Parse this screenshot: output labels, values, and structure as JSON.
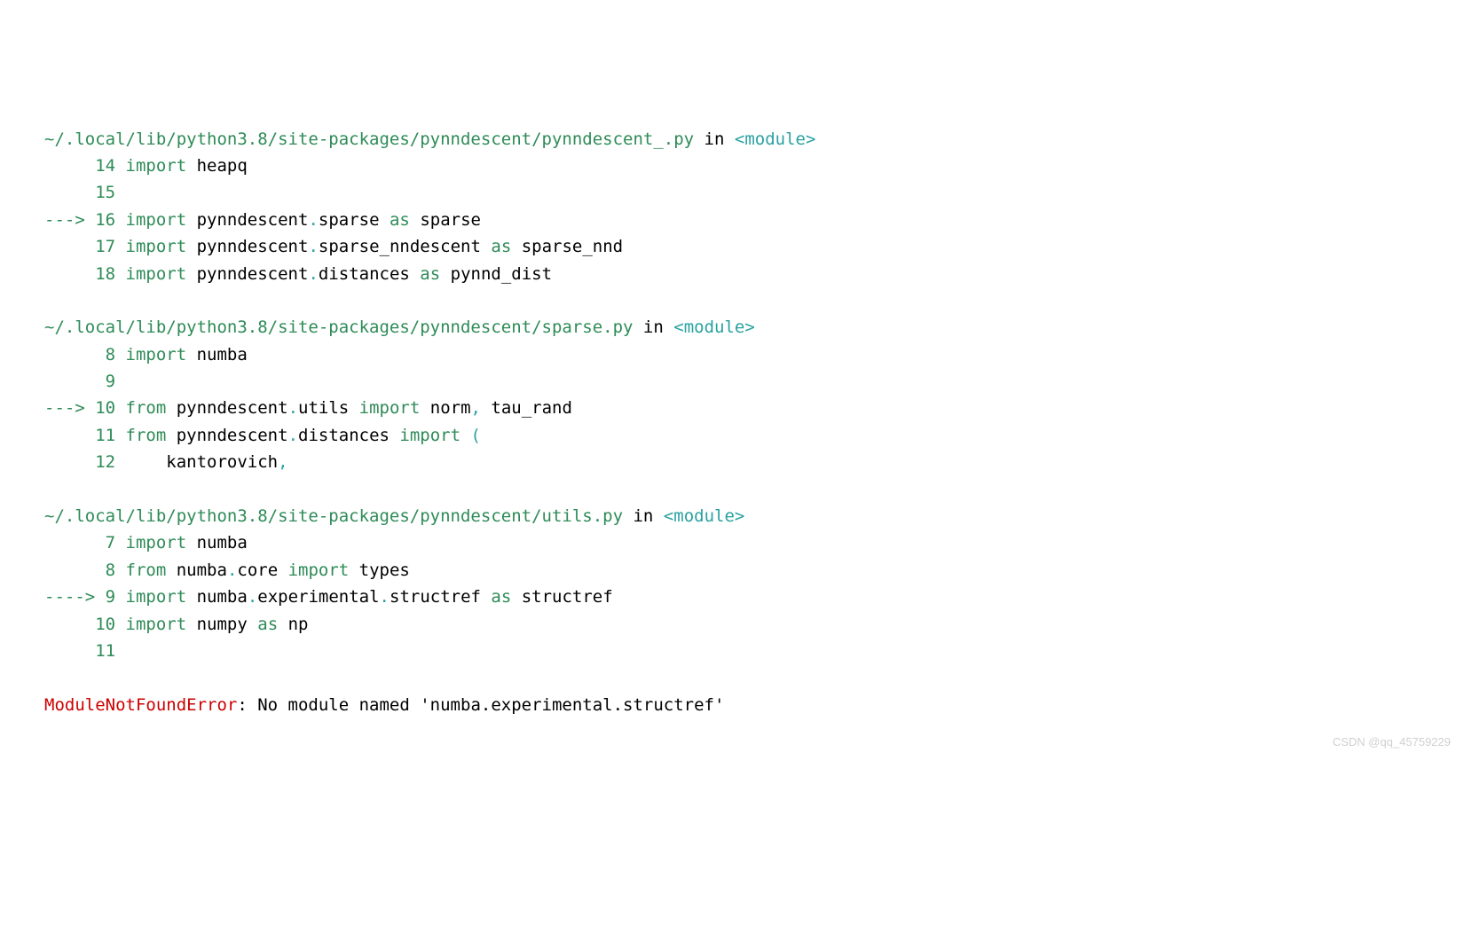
{
  "frames": [
    {
      "path": "~/.local/lib/python3.8/site-packages/pynndescent/pynndescent_.py",
      "in_kw": "in",
      "lt": "<",
      "module": "module",
      "gt": ">",
      "lines": [
        {
          "prefix": "     ",
          "lineno": "14",
          "tokens": [
            {
              "t": "green",
              "v": " import"
            },
            {
              "t": "black",
              "v": " heapq"
            }
          ]
        },
        {
          "prefix": "     ",
          "lineno": "15",
          "tokens": []
        },
        {
          "prefix": "---> ",
          "lineno": "16",
          "tokens": [
            {
              "t": "green",
              "v": " import"
            },
            {
              "t": "black",
              "v": " pynndescent"
            },
            {
              "t": "cyan",
              "v": "."
            },
            {
              "t": "black",
              "v": "sparse "
            },
            {
              "t": "green",
              "v": "as"
            },
            {
              "t": "black",
              "v": " sparse"
            }
          ]
        },
        {
          "prefix": "     ",
          "lineno": "17",
          "tokens": [
            {
              "t": "green",
              "v": " import"
            },
            {
              "t": "black",
              "v": " pynndescent"
            },
            {
              "t": "cyan",
              "v": "."
            },
            {
              "t": "black",
              "v": "sparse_nndescent "
            },
            {
              "t": "green",
              "v": "as"
            },
            {
              "t": "black",
              "v": " sparse_nnd"
            }
          ]
        },
        {
          "prefix": "     ",
          "lineno": "18",
          "tokens": [
            {
              "t": "green",
              "v": " import"
            },
            {
              "t": "black",
              "v": " pynndescent"
            },
            {
              "t": "cyan",
              "v": "."
            },
            {
              "t": "black",
              "v": "distances "
            },
            {
              "t": "green",
              "v": "as"
            },
            {
              "t": "black",
              "v": " pynnd_dist"
            }
          ]
        }
      ]
    },
    {
      "path": "~/.local/lib/python3.8/site-packages/pynndescent/sparse.py",
      "in_kw": "in",
      "lt": "<",
      "module": "module",
      "gt": ">",
      "lines": [
        {
          "prefix": "      ",
          "lineno": "8",
          "tokens": [
            {
              "t": "green",
              "v": " import"
            },
            {
              "t": "black",
              "v": " numba"
            }
          ]
        },
        {
          "prefix": "      ",
          "lineno": "9",
          "tokens": []
        },
        {
          "prefix": "---> ",
          "lineno": "10",
          "tokens": [
            {
              "t": "green",
              "v": " from"
            },
            {
              "t": "black",
              "v": " pynndescent"
            },
            {
              "t": "cyan",
              "v": "."
            },
            {
              "t": "black",
              "v": "utils "
            },
            {
              "t": "green",
              "v": "import"
            },
            {
              "t": "black",
              "v": " norm"
            },
            {
              "t": "cyan",
              "v": ","
            },
            {
              "t": "black",
              "v": " tau_rand"
            }
          ]
        },
        {
          "prefix": "     ",
          "lineno": "11",
          "tokens": [
            {
              "t": "green",
              "v": " from"
            },
            {
              "t": "black",
              "v": " pynndescent"
            },
            {
              "t": "cyan",
              "v": "."
            },
            {
              "t": "black",
              "v": "distances "
            },
            {
              "t": "green",
              "v": "import"
            },
            {
              "t": "cyan",
              "v": " ("
            }
          ]
        },
        {
          "prefix": "     ",
          "lineno": "12",
          "tokens": [
            {
              "t": "black",
              "v": "     kantorovich"
            },
            {
              "t": "cyan",
              "v": ","
            }
          ]
        }
      ]
    },
    {
      "path": "~/.local/lib/python3.8/site-packages/pynndescent/utils.py",
      "in_kw": "in",
      "lt": "<",
      "module": "module",
      "gt": ">",
      "lines": [
        {
          "prefix": "      ",
          "lineno": "7",
          "tokens": [
            {
              "t": "green",
              "v": " import"
            },
            {
              "t": "black",
              "v": " numba"
            }
          ]
        },
        {
          "prefix": "      ",
          "lineno": "8",
          "tokens": [
            {
              "t": "green",
              "v": " from"
            },
            {
              "t": "black",
              "v": " numba"
            },
            {
              "t": "cyan",
              "v": "."
            },
            {
              "t": "black",
              "v": "core "
            },
            {
              "t": "green",
              "v": "import"
            },
            {
              "t": "black",
              "v": " types"
            }
          ]
        },
        {
          "prefix": "----> ",
          "lineno": "9",
          "tokens": [
            {
              "t": "green",
              "v": " import"
            },
            {
              "t": "black",
              "v": " numba"
            },
            {
              "t": "cyan",
              "v": "."
            },
            {
              "t": "black",
              "v": "experimental"
            },
            {
              "t": "cyan",
              "v": "."
            },
            {
              "t": "black",
              "v": "structref "
            },
            {
              "t": "green",
              "v": "as"
            },
            {
              "t": "black",
              "v": " structref"
            }
          ]
        },
        {
          "prefix": "     ",
          "lineno": "10",
          "tokens": [
            {
              "t": "green",
              "v": " import"
            },
            {
              "t": "black",
              "v": " numpy "
            },
            {
              "t": "green",
              "v": "as"
            },
            {
              "t": "black",
              "v": " np"
            }
          ]
        },
        {
          "prefix": "     ",
          "lineno": "11",
          "tokens": []
        }
      ]
    }
  ],
  "error": {
    "name": "ModuleNotFoundError",
    "message": ": No module named 'numba.experimental.structref'"
  },
  "watermark": "CSDN @qq_45759229"
}
